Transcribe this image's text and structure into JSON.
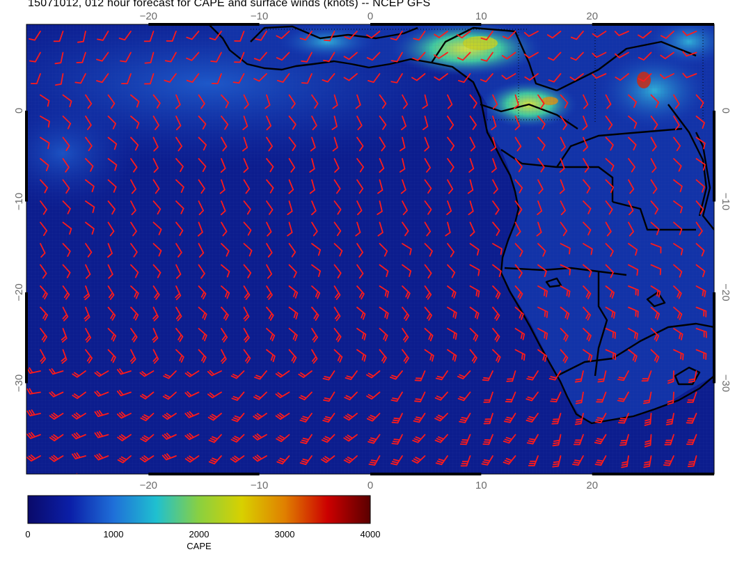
{
  "title": "15071012, 012 hour forecast for CAPE and surface winds (knots) -- NCEP GFS",
  "map": {
    "lon_range": [
      -31,
      31
    ],
    "lat_range": [
      -40,
      9.5
    ],
    "x_ticks": [
      -20,
      -10,
      0,
      10,
      20
    ],
    "y_ticks": [
      0,
      -10,
      -20,
      -30
    ],
    "ocean_color": "#0c1d8e",
    "wind_barb_color": "#ff1a1a",
    "coast_color": "#000000"
  },
  "colorbar": {
    "label": "CAPE",
    "ticks": [
      0,
      1000,
      2000,
      3000,
      4000
    ],
    "range": [
      0,
      4000
    ],
    "stops": [
      "#0a0a6a",
      "#0b1fa8",
      "#1f6fd8",
      "#1fc0d0",
      "#8ad040",
      "#d8d000",
      "#e08000",
      "#cc0000",
      "#5a0000"
    ]
  }
}
